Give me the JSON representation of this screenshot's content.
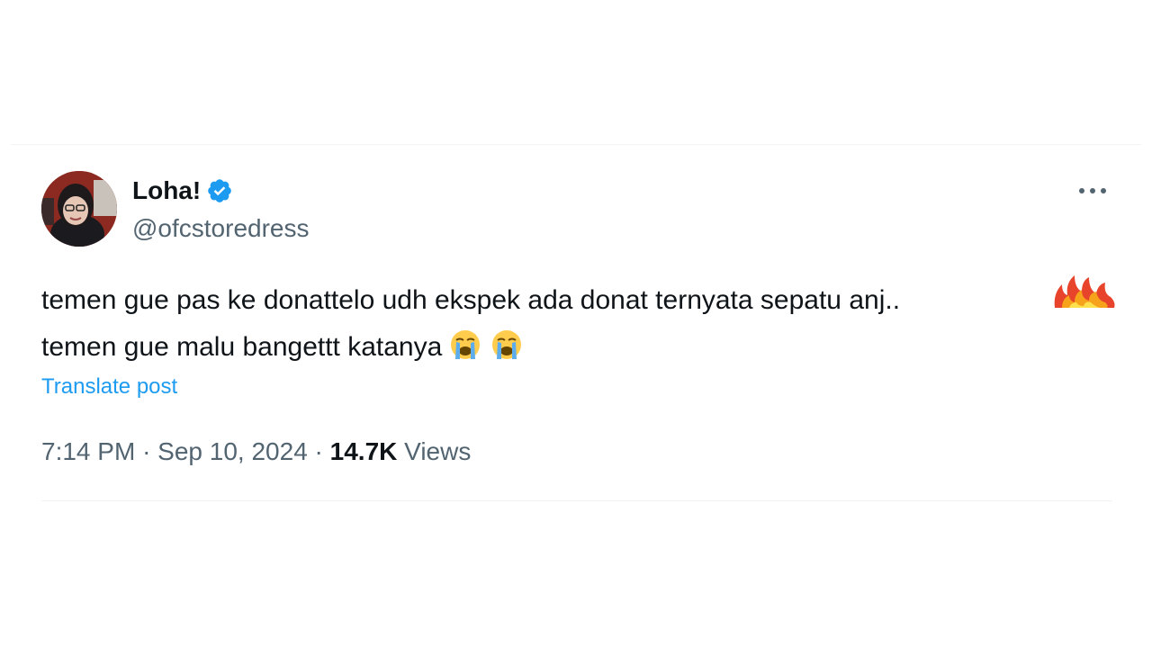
{
  "tweet": {
    "author": {
      "display_name": "Loha!",
      "handle": "@ofcstoredress",
      "verified": true,
      "verified_color": "#1d9bf0"
    },
    "more_icon": "more-horizontal-icon",
    "text_lines": [
      "temen gue pas ke donattelo udh ekspek ada donat ternyata sepatu anj..",
      "temen gue malu bangettt katanya"
    ],
    "emojis_line2": [
      "loudly-crying-face-icon",
      "loudly-crying-face-icon"
    ],
    "translate_label": "Translate post",
    "meta": {
      "time": "7:14 PM",
      "separator": "·",
      "date": "Sep 10, 2024",
      "views_count": "14.7K",
      "views_label": "Views"
    }
  },
  "colors": {
    "accent": "#1d9bf0",
    "text": "#0f1419",
    "secondary_text": "#536471"
  }
}
